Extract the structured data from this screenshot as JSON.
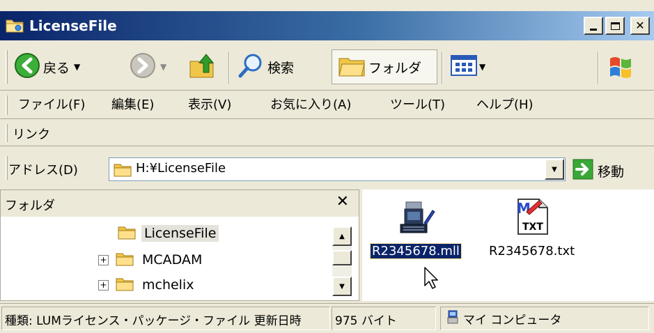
{
  "window": {
    "title": "LicenseFile"
  },
  "toolbar": {
    "back_label": "戻る",
    "search_label": "検索",
    "folders_label": "フォルダ"
  },
  "menu": {
    "items": [
      "ファイル(F)",
      "編集(E)",
      "表示(V)",
      "お気に入り(A)",
      "ツール(T)",
      "ヘルプ(H)"
    ]
  },
  "links": {
    "label": "リンク"
  },
  "address": {
    "label": "アドレス(D)",
    "value": "H:¥LicenseFile",
    "go_label": "移動"
  },
  "folder_pane": {
    "title": "フォルダ",
    "items": [
      {
        "label": "LicenseFile",
        "selected": true
      },
      {
        "label": "MCADAM",
        "expander": "+"
      },
      {
        "label": "mchelix",
        "expander": "+"
      }
    ]
  },
  "files": [
    {
      "name": "R2345678.mll",
      "icon": "computer-icon",
      "selected": true
    },
    {
      "name": "R2345678.txt",
      "icon": "text-file-icon",
      "selected": false
    }
  ],
  "status": {
    "type_text": "種類: LUMライセンス・パッケージ・ファイル 更新日時",
    "size_text": "975 バイト",
    "location_text": "マイ コンピュータ"
  },
  "colors": {
    "title_start": "#0a246a",
    "title_end": "#a6caf0",
    "selection": "#0a246a",
    "face": "#ece9d8"
  }
}
